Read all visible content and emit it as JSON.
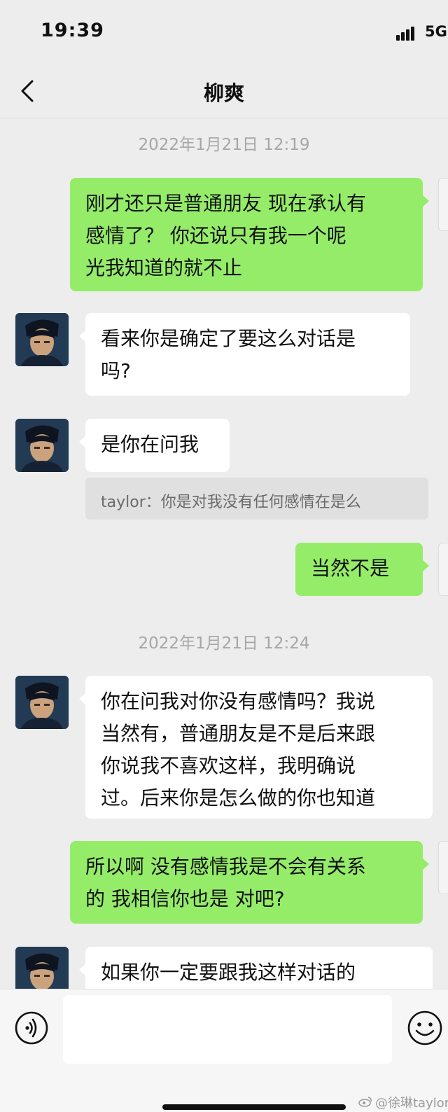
{
  "status_bar": {
    "time": "19:39",
    "network": "5G"
  },
  "header": {
    "title": "柳爽"
  },
  "messages": {
    "ts1": "2022年1月21日 12:19",
    "m1": "刚才还只是普通朋友 现在承认有\n感情了？ 你还说只有我一个呢\n光我知道的就不止",
    "m2": "看来你是确定了要这么对话是\n吗?",
    "m3": "是你在问我",
    "quote": "taylor：你是对我没有任何感情在是么",
    "m4": "当然不是",
    "ts2": "2022年1月21日 12:24",
    "m5": "你在问我对你没有感情吗？我说\n当然有，普通朋友是不是后来跟\n你说我不喜欢这样，我明确说\n过。后来你是怎么做的你也知道",
    "m6": "所以啊 没有感情我是不会有关系\n的 我相信你也是 对吧?",
    "m7": "如果你一定要跟我这样对话的"
  },
  "input_bar": {
    "value": "",
    "placeholder": ""
  },
  "watermark": "@徐琳taylor",
  "colors": {
    "background": "#ededed",
    "outgoing_bubble": "#95ec69",
    "incoming_bubble": "#ffffff",
    "timestamp": "#a6a6a6"
  },
  "icons": {
    "back": "chevron-left-icon",
    "voice": "voice-icon",
    "emoji": "emoji-icon",
    "signal": "signal-icon",
    "watermark_logo": "weibo-icon"
  }
}
